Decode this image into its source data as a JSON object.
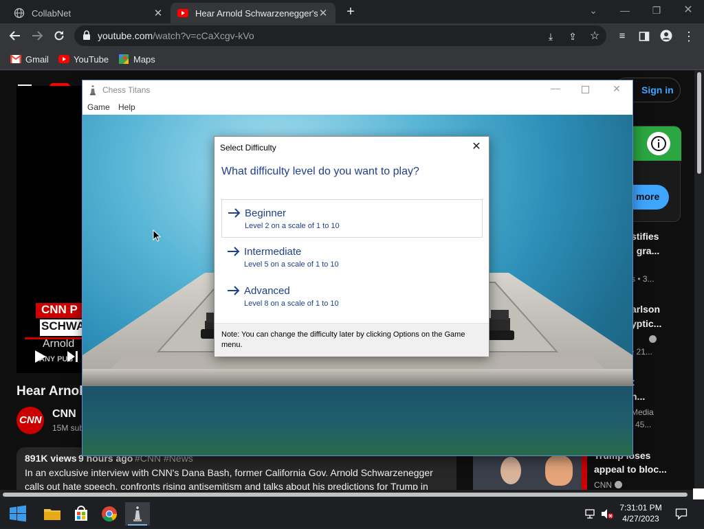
{
  "browser": {
    "tabs": [
      {
        "title": "CollabNet",
        "active": false
      },
      {
        "title": "Hear Arnold Schwarzenegger's p",
        "active": true
      }
    ],
    "url_host": "youtube.com",
    "url_path": "/watch?v=cCaXcgv-kVo",
    "bookmarks": [
      "Gmail",
      "YouTube",
      "Maps"
    ]
  },
  "youtube": {
    "sign_in": "Sign in",
    "more": "more",
    "video_title": "Hear Arnold",
    "channel": "CNN",
    "subs": "15M sub",
    "views": "891K views",
    "age": "9 hours ago",
    "tags": "#CNN #News",
    "desc_line1": "In an exclusive interview with CNN's Dana Bash, former California Gov. Arnold Schwarzenegger",
    "desc_line2": "calls out hate speech, confronts rising antisemitism and talks about his predictions for Trump in",
    "thumb_lines": [
      "CNN P",
      "SCHWAR",
      "Arnold",
      "ANY PUB"
    ],
    "sidebar": [
      {
        "l1": "stifies",
        "l2": "l gra...",
        "l3": "s  • 3..."
      },
      {
        "l1": "arlson",
        "l2": "yptic...",
        "l3": "• 21..."
      },
      {
        "l1": "t",
        "l2": "n...",
        "l3": "Media",
        "l4": "45..."
      },
      {
        "l1": "Trump loses",
        "l2": "appeal to bloc...",
        "l3": "CNN"
      }
    ]
  },
  "chess_window": {
    "title": "Chess Titans",
    "menu": [
      "Game",
      "Help"
    ]
  },
  "dialog": {
    "title": "Select Difficulty",
    "question": "What difficulty level do you want to play?",
    "options": [
      {
        "name": "Beginner",
        "desc": "Level 2 on a scale of 1 to 10"
      },
      {
        "name": "Intermediate",
        "desc": "Level 5 on a scale of 1 to 10"
      },
      {
        "name": "Advanced",
        "desc": "Level 8 on a scale of 1 to 10"
      }
    ],
    "note": "Note: You can change the difficulty later by clicking Options on the Game menu."
  },
  "taskbar": {
    "time": "7:31:01 PM",
    "date": "4/27/2023"
  }
}
